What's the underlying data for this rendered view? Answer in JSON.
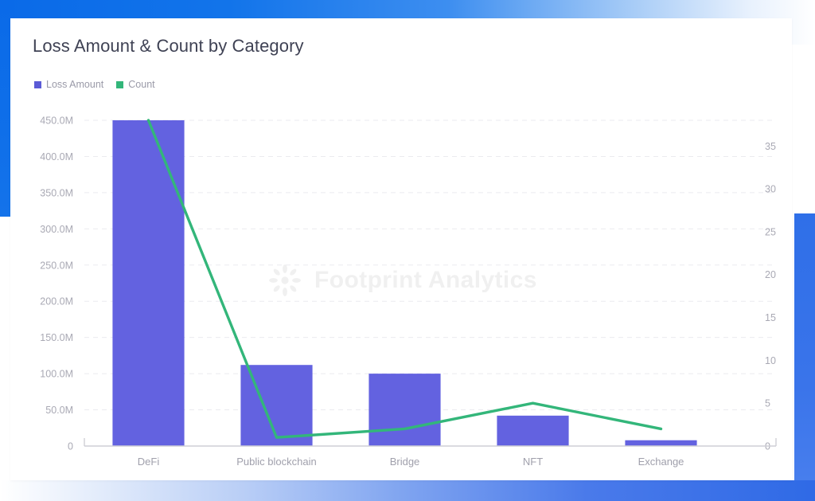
{
  "card": {
    "title": "Loss Amount & Count by Category",
    "watermark_text": "Footprint Analytics",
    "watermark_icon": "sunburst-logo-icon"
  },
  "legend": {
    "items": [
      {
        "label": "Loss Amount",
        "color": "#5b5bd6"
      },
      {
        "label": "Count",
        "color": "#33b67a"
      }
    ]
  },
  "colors": {
    "bar": "#6362e0",
    "line": "#33b67a",
    "grid": "#ebebef",
    "axis": "#cfcfd6",
    "tick_text": "#a9a9b4",
    "title_text": "#3f4254",
    "legend_text": "#9a9aa8",
    "watermark": "#f0f0f0",
    "page_blue": "#0a6ae8"
  },
  "chart_data": {
    "type": "bar",
    "title": "Loss Amount & Count by Category",
    "xlabel": "",
    "ylabel": "Loss Amount",
    "y2label": "Count",
    "grid": true,
    "legend_position": "top-left",
    "categories": [
      "DeFi",
      "Public blockchain",
      "Bridge",
      "NFT",
      "Exchange"
    ],
    "series": [
      {
        "name": "Loss Amount",
        "type": "bar",
        "axis": "left",
        "color": "#6362e0",
        "values": [
          450000000,
          112000000,
          100000000,
          42000000,
          8000000
        ]
      },
      {
        "name": "Count",
        "type": "line",
        "axis": "right",
        "color": "#33b67a",
        "values": [
          38,
          1,
          2,
          5,
          2
        ]
      }
    ],
    "ylim": [
      0,
      450000000
    ],
    "y2lim": [
      0,
      38
    ],
    "y_ticks": [
      {
        "value": 0,
        "label": "0"
      },
      {
        "value": 50000000,
        "label": "50.0M"
      },
      {
        "value": 100000000,
        "label": "100.0M"
      },
      {
        "value": 150000000,
        "label": "150.0M"
      },
      {
        "value": 200000000,
        "label": "200.0M"
      },
      {
        "value": 250000000,
        "label": "250.0M"
      },
      {
        "value": 300000000,
        "label": "300.0M"
      },
      {
        "value": 350000000,
        "label": "350.0M"
      },
      {
        "value": 400000000,
        "label": "400.0M"
      },
      {
        "value": 450000000,
        "label": "450.0M"
      }
    ],
    "y2_ticks": [
      {
        "value": 0,
        "label": "0"
      },
      {
        "value": 5,
        "label": "5"
      },
      {
        "value": 10,
        "label": "10"
      },
      {
        "value": 15,
        "label": "15"
      },
      {
        "value": 20,
        "label": "20"
      },
      {
        "value": 25,
        "label": "25"
      },
      {
        "value": 30,
        "label": "30"
      },
      {
        "value": 35,
        "label": "35"
      }
    ]
  }
}
